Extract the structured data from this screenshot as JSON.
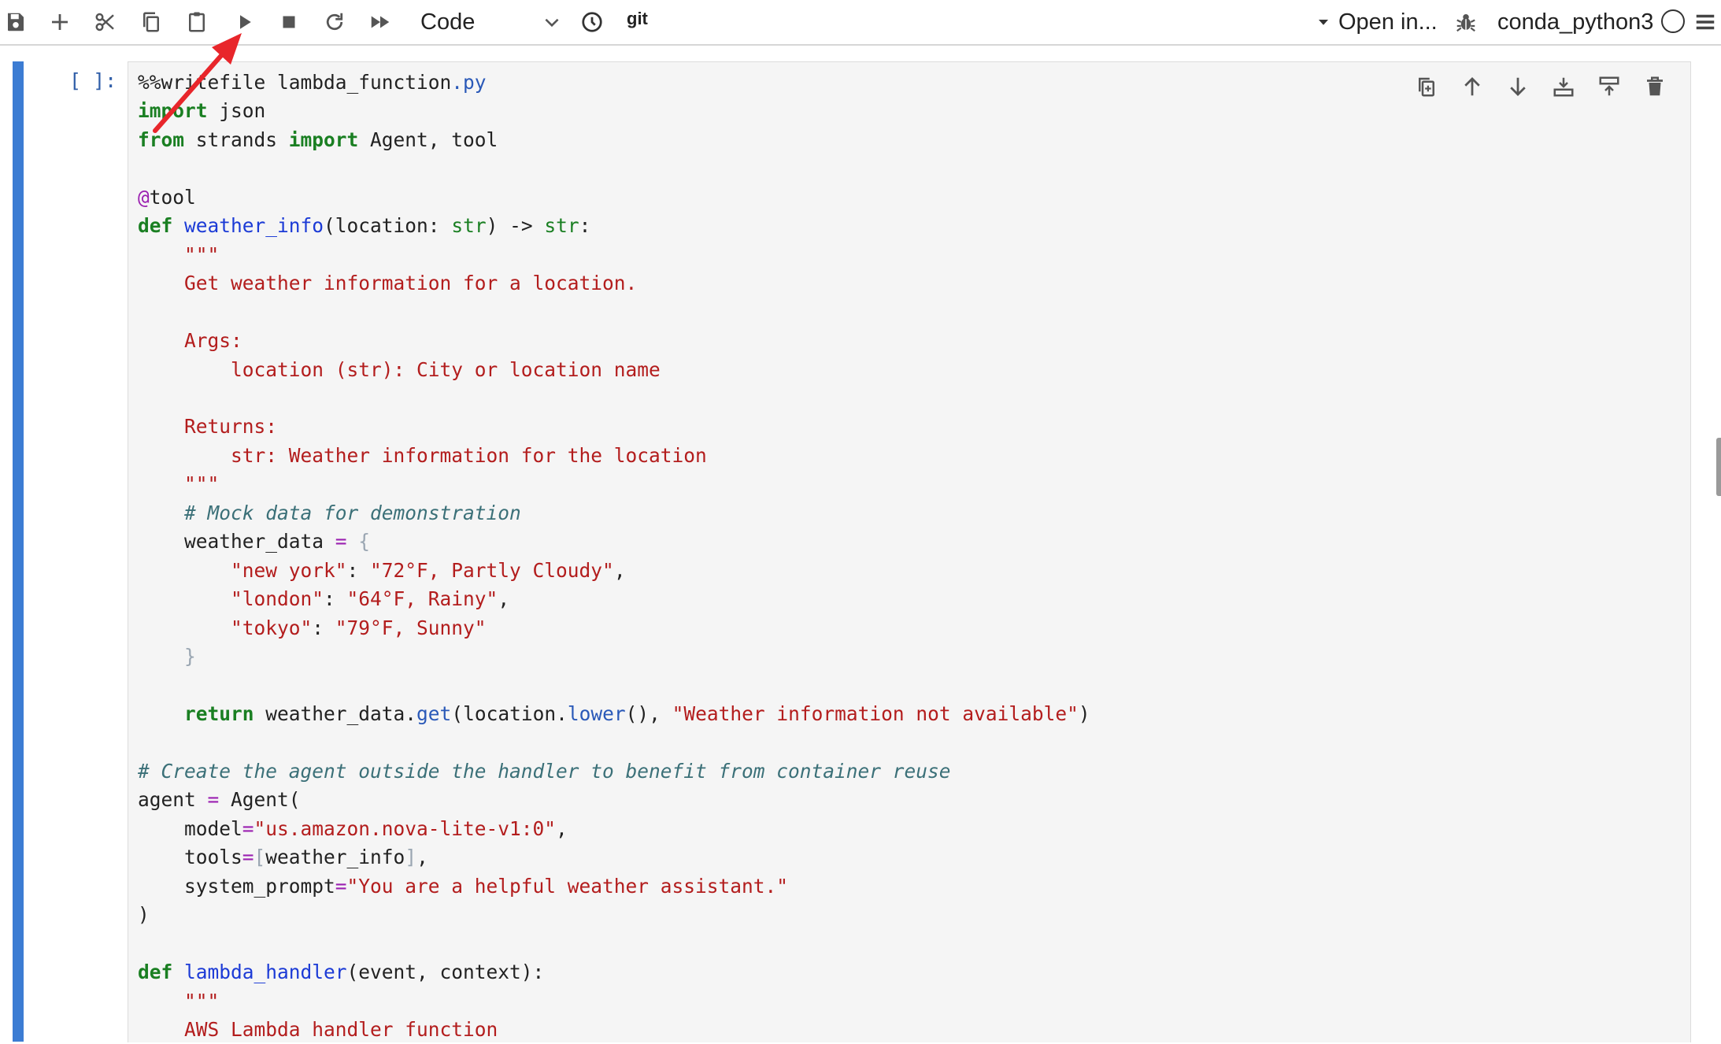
{
  "toolbar": {
    "buttons": [
      {
        "id": "save",
        "icon": "save-icon"
      },
      {
        "id": "add",
        "icon": "plus-icon"
      },
      {
        "id": "cut",
        "icon": "scissors-icon"
      },
      {
        "id": "copy",
        "icon": "copy-icon"
      },
      {
        "id": "paste",
        "icon": "paste-icon"
      },
      {
        "id": "run",
        "icon": "play-icon"
      },
      {
        "id": "interrupt",
        "icon": "stop-icon"
      },
      {
        "id": "restart",
        "icon": "restart-icon"
      },
      {
        "id": "restart-run-all",
        "icon": "fast-forward-icon"
      }
    ],
    "cell_type": "Code",
    "history_icon": "clock-icon",
    "git_label": "git",
    "open_in_label": "Open in...",
    "debugger_icon": "bug-icon",
    "kernel_name": "conda_python3",
    "kernel_status_icon": "circle-icon",
    "menu_icon": "hamburger-icon"
  },
  "cell": {
    "prompt": "[ ]:",
    "tools": [
      {
        "id": "duplicate",
        "icon": "duplicate-icon"
      },
      {
        "id": "move-up",
        "icon": "arrow-up-icon"
      },
      {
        "id": "move-down",
        "icon": "arrow-down-icon"
      },
      {
        "id": "insert-above",
        "icon": "insert-above-icon"
      },
      {
        "id": "insert-below",
        "icon": "insert-below-icon"
      },
      {
        "id": "delete",
        "icon": "trash-icon"
      }
    ],
    "code_lines": [
      [
        [
          "",
          "%%writefile lambda_function"
        ],
        [
          "mt",
          "."
        ],
        [
          "mt",
          "py"
        ]
      ],
      [
        [
          "kw",
          "import"
        ],
        [
          "",
          " json"
        ]
      ],
      [
        [
          "kw",
          "from"
        ],
        [
          "",
          " strands "
        ],
        [
          "kw",
          "import"
        ],
        [
          "",
          " Agent, tool"
        ]
      ],
      [],
      [
        [
          "op",
          "@"
        ],
        [
          "",
          "tool"
        ]
      ],
      [
        [
          "kw",
          "def"
        ],
        [
          "",
          " "
        ],
        [
          "fn",
          "weather_info"
        ],
        [
          "",
          "(location: "
        ],
        [
          "bi",
          "str"
        ],
        [
          "",
          ") -> "
        ],
        [
          "bi",
          "str"
        ],
        [
          "",
          ":"
        ]
      ],
      [
        [
          "",
          "    "
        ],
        [
          "st",
          "\"\"\""
        ]
      ],
      [
        [
          "",
          "    "
        ],
        [
          "st",
          "Get weather information for a location."
        ]
      ],
      [],
      [
        [
          "",
          "    "
        ],
        [
          "st",
          "Args:"
        ]
      ],
      [
        [
          "",
          "        "
        ],
        [
          "st",
          "location (str): City or location name"
        ]
      ],
      [],
      [
        [
          "",
          "    "
        ],
        [
          "st",
          "Returns:"
        ]
      ],
      [
        [
          "",
          "        "
        ],
        [
          "st",
          "str: Weather information for the location"
        ]
      ],
      [
        [
          "",
          "    "
        ],
        [
          "st",
          "\"\"\""
        ]
      ],
      [
        [
          "",
          "    "
        ],
        [
          "cm",
          "# Mock data for demonstration"
        ]
      ],
      [
        [
          "",
          "    weather_data "
        ],
        [
          "op",
          "="
        ],
        [
          "",
          " "
        ],
        [
          "br",
          "{"
        ]
      ],
      [
        [
          "",
          "        "
        ],
        [
          "st",
          "\"new york\""
        ],
        [
          "",
          ": "
        ],
        [
          "st",
          "\"72°F, Partly Cloudy\""
        ],
        [
          "",
          ","
        ]
      ],
      [
        [
          "",
          "        "
        ],
        [
          "st",
          "\"london\""
        ],
        [
          "",
          ": "
        ],
        [
          "st",
          "\"64°F, Rainy\""
        ],
        [
          "",
          ","
        ]
      ],
      [
        [
          "",
          "        "
        ],
        [
          "st",
          "\"tokyo\""
        ],
        [
          "",
          ": "
        ],
        [
          "st",
          "\"79°F, Sunny\""
        ]
      ],
      [
        [
          "",
          "    "
        ],
        [
          "br",
          "}"
        ]
      ],
      [],
      [
        [
          "",
          "    "
        ],
        [
          "kw",
          "return"
        ],
        [
          "",
          " weather_data."
        ],
        [
          "mt",
          "get"
        ],
        [
          "",
          "(location."
        ],
        [
          "mt",
          "lower"
        ],
        [
          "",
          "(), "
        ],
        [
          "st",
          "\"Weather information not available\""
        ],
        [
          "",
          ")"
        ]
      ],
      [],
      [
        [
          "cm",
          "# Create the agent outside the handler to benefit from container reuse"
        ]
      ],
      [
        [
          "",
          "agent "
        ],
        [
          "op",
          "="
        ],
        [
          "",
          " Agent("
        ]
      ],
      [
        [
          "",
          "    model"
        ],
        [
          "op",
          "="
        ],
        [
          "st",
          "\"us.amazon.nova-lite-v1:0\""
        ],
        [
          "",
          ","
        ]
      ],
      [
        [
          "",
          "    tools"
        ],
        [
          "op",
          "="
        ],
        [
          "br",
          "["
        ],
        [
          "",
          "weather_info"
        ],
        [
          "br",
          "]"
        ],
        [
          "",
          ","
        ]
      ],
      [
        [
          "",
          "    system_prompt"
        ],
        [
          "op",
          "="
        ],
        [
          "st",
          "\"You are a helpful weather assistant.\""
        ]
      ],
      [
        [
          "",
          ")"
        ]
      ],
      [],
      [
        [
          "kw",
          "def"
        ],
        [
          "",
          " "
        ],
        [
          "fn",
          "lambda_handler"
        ],
        [
          "",
          "(event, context):"
        ]
      ],
      [
        [
          "",
          "    "
        ],
        [
          "st",
          "\"\"\""
        ]
      ],
      [
        [
          "",
          "    "
        ],
        [
          "st",
          "AWS Lambda handler function"
        ]
      ]
    ]
  },
  "colors": {
    "accent": "#3c7cd3",
    "keyword": "#1a7f22",
    "string": "#b31d1d",
    "comment": "#3b7078",
    "function": "#1c3bd6",
    "annotation_arrow": "#e8262b"
  }
}
